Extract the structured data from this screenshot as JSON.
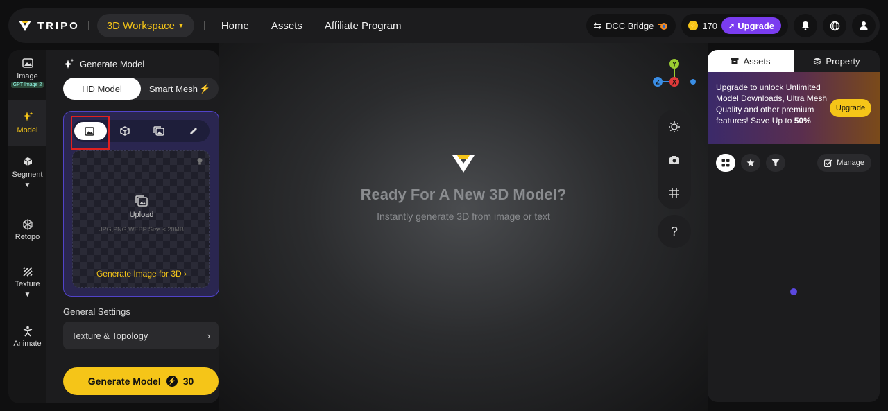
{
  "topbar": {
    "brand": "TRIPO",
    "workspace": "3D Workspace",
    "nav": [
      "Home",
      "Assets",
      "Affiliate Program"
    ],
    "dcc_bridge": "DCC Bridge",
    "credits": "170",
    "upgrade": "Upgrade"
  },
  "rail": {
    "items": [
      {
        "label": "Image",
        "badge": "GPT Image 2"
      },
      {
        "label": "Model"
      },
      {
        "label": "Segment"
      },
      {
        "label": "Retopo"
      },
      {
        "label": "Texture"
      },
      {
        "label": "Animate"
      }
    ]
  },
  "panel": {
    "title": "Generate Model",
    "modes": [
      "HD Model",
      "Smart Mesh"
    ],
    "upload_label": "Upload",
    "upload_hint": "JPG,PNG,WEBP Size ≤ 20MB",
    "gen_image_link": "Generate Image for 3D",
    "settings_label": "General Settings",
    "texture_topology": "Texture & Topology",
    "generate_label": "Generate Model",
    "generate_cost": "30"
  },
  "viewport": {
    "title": "Ready For A New 3D Model?",
    "subtitle": "Instantly generate 3D from image or text",
    "help": "?"
  },
  "right_panel": {
    "tabs": [
      "Assets",
      "Property"
    ],
    "promo_line1": "Upgrade to unlock Unlimited Model Downloads, Ultra Mesh Quality and other premium features!  Save Up to ",
    "promo_percent": "50%",
    "promo_btn": "Upgrade",
    "manage": "Manage"
  },
  "colors": {
    "accent": "#f5c518",
    "purple": "#7a3cf0",
    "panel": "#1c1c1e"
  }
}
